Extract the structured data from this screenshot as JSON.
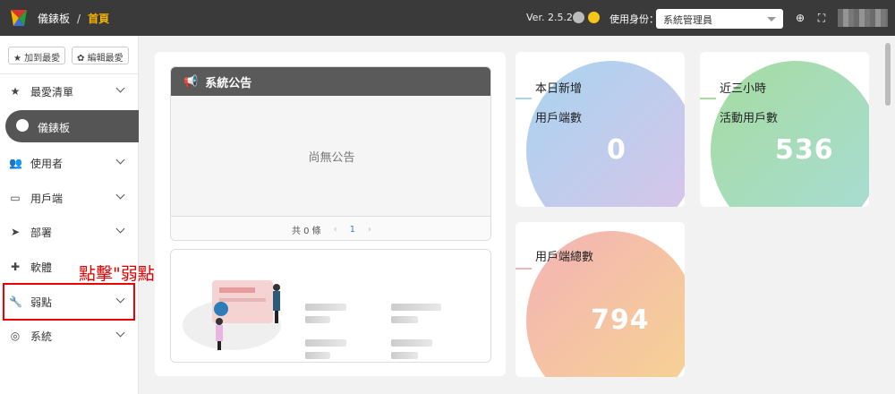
{
  "header": {
    "app_name": "儀錶板",
    "separator": "/",
    "current_page": "首頁",
    "version": "Ver. 2.5.2",
    "role_label": "使用身份：",
    "role_value": "系統管理員"
  },
  "sidebar": {
    "add_fav_label": "加到最愛",
    "edit_fav_label": "編輯最愛",
    "items": [
      {
        "label": "最愛清單",
        "icon": "star-icon"
      },
      {
        "label": "儀錶板",
        "icon": "dashboard-icon",
        "active": true
      },
      {
        "label": "使用者",
        "icon": "users-icon"
      },
      {
        "label": "用戶端",
        "icon": "monitor-icon"
      },
      {
        "label": "部署",
        "icon": "send-icon"
      },
      {
        "label": "軟體",
        "icon": "puzzle-icon"
      },
      {
        "label": "弱點",
        "icon": "wrench-icon"
      },
      {
        "label": "系統",
        "icon": "globe-icon"
      }
    ]
  },
  "annotation": "點擊\"弱點\"展開選單",
  "announcement": {
    "title": "系統公告",
    "empty_text": "尚無公告",
    "total_text": "共 0 條",
    "page": "1"
  },
  "stats": [
    {
      "line1": "本日新增",
      "line2": "用戶端數",
      "value": "0"
    },
    {
      "line1": "近三小時",
      "line2": "活動用戶數",
      "value": "536"
    },
    {
      "line1": "用戶端總數",
      "line2": "",
      "value": "794"
    }
  ],
  "colors": {
    "topbar": "#3a3a3a",
    "accent": "#f5b400",
    "highlight": "#e00000"
  }
}
